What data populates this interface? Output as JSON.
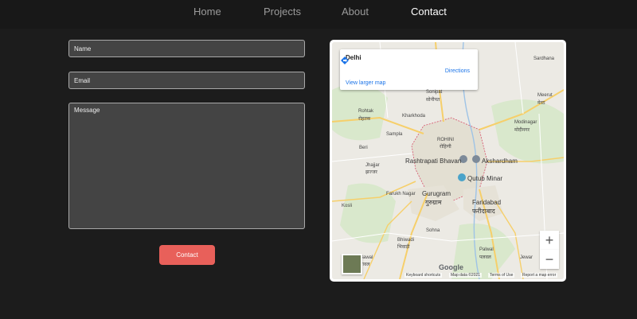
{
  "nav": {
    "items": [
      {
        "label": "Home",
        "active": false
      },
      {
        "label": "Projects",
        "active": false
      },
      {
        "label": "About",
        "active": false
      },
      {
        "label": "Contact",
        "active": true
      }
    ]
  },
  "form": {
    "name_placeholder": "Name",
    "email_placeholder": "Email",
    "message_placeholder": "Message",
    "send_label": "Contact"
  },
  "map": {
    "place_name": "Delhi",
    "directions_label": "Directions",
    "larger_map_label": "View larger map",
    "zoom_in": "+",
    "zoom_out": "−",
    "google_logo": "Google",
    "footer": {
      "shortcuts": "Keyboard shortcuts",
      "map_data": "Map data ©2021",
      "terms": "Terms of Use",
      "report": "Report a map error"
    },
    "labels": {
      "rohtak": "Rohtak",
      "rohtak_hi": "रोहतक",
      "sonipat": "Sonipat",
      "sonipat_hi": "सोनीपत",
      "meerut": "Meerut",
      "meerut_hi": "मेरठ",
      "modinagar": "Modinagar",
      "modinagar_hi": "मोदीनगर",
      "rohini": "ROHINI",
      "rohini_hi": "रोहिणी",
      "rashtrapati": "Rashtrapati Bhavan",
      "akshardham": "Akshardham",
      "qutub": "Qutub Minar",
      "gurugram": "Gurugram",
      "gurugram_hi": "गुरुग्राम",
      "faridabad": "Faridabad",
      "faridabad_hi": "फरीदाबाद",
      "jhajjar": "Jhajjar",
      "jhajjar_hi": "झज्जर",
      "bhiwadi": "Bhiwadi",
      "bhiwadi_hi": "भिवाड़ी",
      "palwal": "Palwal",
      "palwal_hi": "पलवल",
      "bawal": "Bawal",
      "bawal_hi": "बावल",
      "kharkhoda": "Kharkhoda",
      "sampla": "Sampla",
      "sohna": "Sohna",
      "sardhana": "Sardhana",
      "kosli": "Kosli",
      "beri": "Beri",
      "farukh": "Farukh Nagar",
      "jewar": "Jewar"
    },
    "colors": {
      "land": "#eceae4",
      "green": "#cfe3c2",
      "urban": "#e4e0d4",
      "road_major": "#f6cf6a",
      "road_minor": "#ffffff",
      "border": "#d6506a",
      "water": "#9ec3e6"
    }
  }
}
